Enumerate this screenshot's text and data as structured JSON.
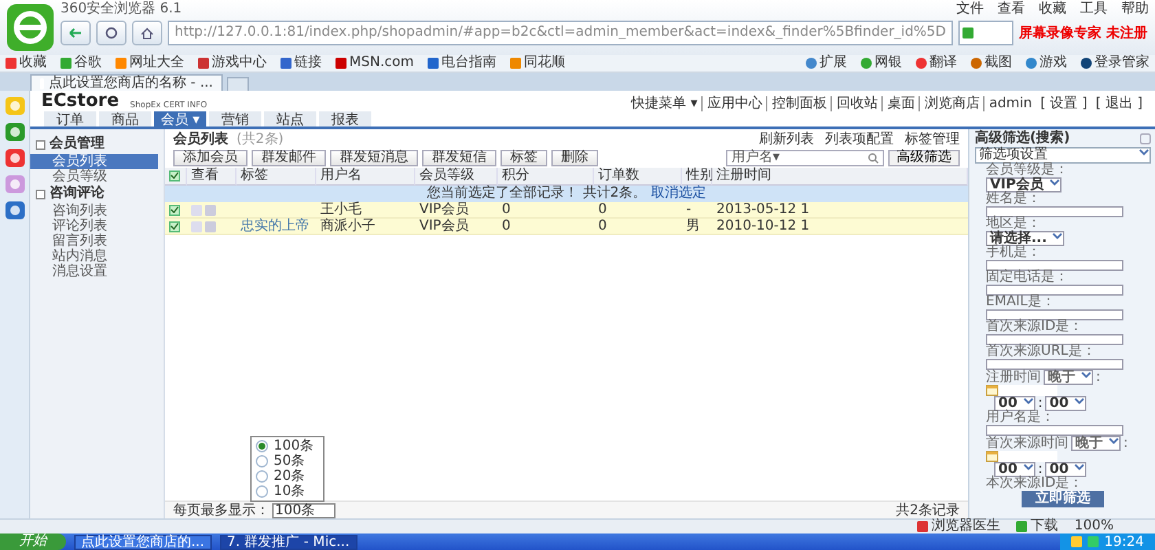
{
  "browser": {
    "title": "360安全浏览器 6.1",
    "menu": [
      "文件",
      "查看",
      "收藏",
      "工具",
      "帮助"
    ],
    "url": "http://127.0.0.1:81/index.php/shopadmin/#app=b2c&ctl=admin_member&act=index&_finder%5Bfinder_id%5D",
    "recorder_notice": "屏幕录像专家 未注册",
    "bookmarks": [
      "收藏",
      "谷歌",
      "网址大全",
      "游戏中心",
      "链接",
      "MSN.com",
      "电台指南",
      "同花顺"
    ],
    "extensions": [
      "扩展",
      "网银",
      "翻译",
      "截图",
      "游戏",
      "登录管家"
    ],
    "tabs": [
      {
        "label": "点此设置您商店的名称 - ...",
        "selected": true
      }
    ]
  },
  "admin": {
    "logo": "ECstore",
    "cert": "ShopEx CERT INFO",
    "quick_links": [
      "快捷菜单 ▾",
      "应用中心",
      "控制面板",
      "回收站",
      "桌面",
      "浏览商店"
    ],
    "user": "admin",
    "user_links": [
      "[ 设置 ]",
      "[ 退出 ]"
    ],
    "nav": [
      {
        "label": "订单",
        "selected": false
      },
      {
        "label": "商品",
        "selected": false
      },
      {
        "label": "会员 ▾",
        "selected": true
      },
      {
        "label": "营销",
        "selected": false
      },
      {
        "label": "站点",
        "selected": false
      },
      {
        "label": "报表",
        "selected": false
      }
    ]
  },
  "sidebar": [
    {
      "title": "会员管理",
      "items": [
        {
          "label": "会员列表",
          "selected": true
        },
        {
          "label": "会员等级",
          "selected": false
        }
      ]
    },
    {
      "title": "咨询评论",
      "items": [
        {
          "label": "咨询列表",
          "selected": false
        },
        {
          "label": "评论列表",
          "selected": false
        },
        {
          "label": "留言列表",
          "selected": false
        },
        {
          "label": "站内消息",
          "selected": false
        },
        {
          "label": "消息设置",
          "selected": false
        }
      ]
    }
  ],
  "list": {
    "title": "会员列表",
    "count": "(共2条)",
    "links": [
      "刷新列表",
      "列表项配置",
      "标签管理"
    ],
    "actions": [
      "添加会员",
      "群发邮件",
      "群发短消息",
      "群发短信",
      "标签",
      "删除"
    ],
    "search": {
      "scope": "用户名▾"
    },
    "advanced_button": "高级筛选",
    "header_checked": true,
    "columns": [
      "查看",
      "标签",
      "用户名",
      "会员等级",
      "积分",
      "订单数",
      "性别",
      "注册时间"
    ],
    "notice": "您当前选定了全部记录！ 共计2条。",
    "notice_link": "取消选定",
    "rows": [
      {
        "checked": true,
        "username": "王小毛",
        "level": "VIP会员",
        "points": "0",
        "orders": "0",
        "gender": "-",
        "registered": "2013-05-12 1"
      },
      {
        "checked": true,
        "tag": "忠实的上帝",
        "username": "商派小子",
        "level": "VIP会员",
        "points": "0",
        "orders": "0",
        "gender": "男",
        "registered": "2010-10-12 1"
      }
    ]
  },
  "pager": {
    "label": "每页最多显示：",
    "value": "100条",
    "total": "共2条记录",
    "options": [
      {
        "label": "100条",
        "selected": true
      },
      {
        "label": "50条",
        "selected": false
      },
      {
        "label": "20条",
        "selected": false
      },
      {
        "label": "10条",
        "selected": false
      }
    ]
  },
  "filter": {
    "title": "高级筛选(搜索)",
    "preset": "筛选项设置",
    "submit": "立即筛选",
    "fields": [
      {
        "kind": "select",
        "label": "会员等级是：",
        "value": "VIP会员"
      },
      {
        "kind": "text",
        "label": "姓名是："
      },
      {
        "kind": "select",
        "label": "地区是：",
        "value": "请选择..."
      },
      {
        "kind": "text",
        "label": "手机是："
      },
      {
        "kind": "text",
        "label": "固定电话是："
      },
      {
        "kind": "text",
        "label": "EMAIL是："
      },
      {
        "kind": "text",
        "label": "首次来源ID是："
      },
      {
        "kind": "text",
        "label": "首次来源URL是："
      },
      {
        "kind": "datetime",
        "label": "注册时间",
        "relation": "晚于",
        "suffix": ":",
        "hour": "00",
        "time_separator": ":",
        "minute": "00"
      },
      {
        "kind": "text",
        "label": "用户名是："
      },
      {
        "kind": "datetime",
        "label": "首次来源时间",
        "relation": "晚于",
        "suffix": ":",
        "hour": "00",
        "time_separator": ":",
        "minute": "00"
      },
      {
        "kind": "label",
        "label": "本次来源ID是："
      }
    ]
  },
  "status_bar": {
    "items": [
      "浏览器医生",
      "下载"
    ],
    "zoom": "100%"
  },
  "taskbar": {
    "start": "开始",
    "tasks": [
      {
        "label": "点此设置您商店的...",
        "selected": false
      },
      {
        "label": "7. 群发推广 - Mic...",
        "selected": true
      }
    ],
    "clock": "19:24"
  }
}
